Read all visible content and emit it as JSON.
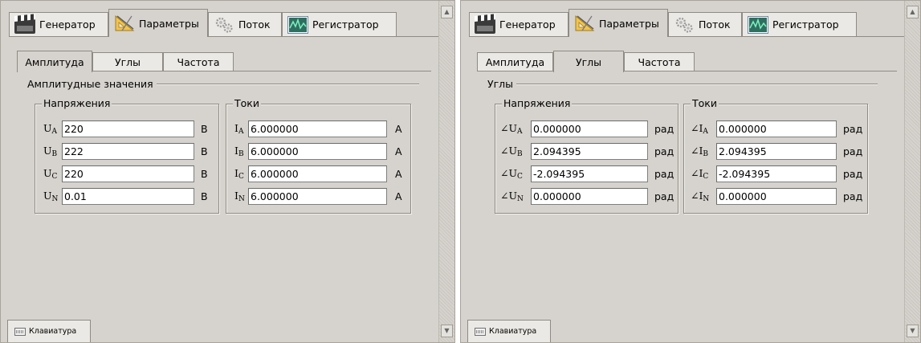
{
  "main_tabs": [
    "Генератор",
    "Параметры",
    "Поток",
    "Регистратор"
  ],
  "sub_tabs": [
    "Амплитуда",
    "Углы",
    "Частота"
  ],
  "keyboard_tab_label": "Клавиатура",
  "left": {
    "section_title": "Амплитудные значения",
    "voltage_group": {
      "title": "Напряжения",
      "rows": [
        {
          "prefix": "U",
          "sub": "A",
          "value": "220",
          "unit": "В"
        },
        {
          "prefix": "U",
          "sub": "B",
          "value": "222",
          "unit": "В"
        },
        {
          "prefix": "U",
          "sub": "C",
          "value": "220",
          "unit": "В"
        },
        {
          "prefix": "U",
          "sub": "N",
          "value": "0.01",
          "unit": "В"
        }
      ]
    },
    "current_group": {
      "title": "Токи",
      "rows": [
        {
          "prefix": "I",
          "sub": "A",
          "value": "6.000000",
          "unit": "А"
        },
        {
          "prefix": "I",
          "sub": "B",
          "value": "6.000000",
          "unit": "А"
        },
        {
          "prefix": "I",
          "sub": "C",
          "value": "6.000000",
          "unit": "А"
        },
        {
          "prefix": "I",
          "sub": "N",
          "value": "6.000000",
          "unit": "А"
        }
      ]
    }
  },
  "right": {
    "section_title": "Углы",
    "voltage_group": {
      "title": "Напряжения",
      "rows": [
        {
          "prefix": "∠U",
          "sub": "A",
          "value": "0.000000",
          "unit": "рад"
        },
        {
          "prefix": "∠U",
          "sub": "B",
          "value": "2.094395",
          "unit": "рад"
        },
        {
          "prefix": "∠U",
          "sub": "C",
          "value": "-2.094395",
          "unit": "рад"
        },
        {
          "prefix": "∠U",
          "sub": "N",
          "value": "0.000000",
          "unit": "рад"
        }
      ]
    },
    "current_group": {
      "title": "Токи",
      "rows": [
        {
          "prefix": "∠I",
          "sub": "A",
          "value": "0.000000",
          "unit": "рад"
        },
        {
          "prefix": "∠I",
          "sub": "B",
          "value": "2.094395",
          "unit": "рад"
        },
        {
          "prefix": "∠I",
          "sub": "C",
          "value": "-2.094395",
          "unit": "рад"
        },
        {
          "prefix": "∠I",
          "sub": "N",
          "value": "0.000000",
          "unit": "рад"
        }
      ]
    }
  },
  "icons": {
    "generator": "clapperboard-icon",
    "parameters": "ruler-triangle-icon",
    "flow": "gears-icon",
    "recorder": "oscilloscope-icon",
    "keyboard": "keyboard-icon"
  },
  "colors": {
    "panel_bg": "#d6d3ce",
    "tab_bg": "#ebe9e5",
    "border": "#8e8a83"
  }
}
